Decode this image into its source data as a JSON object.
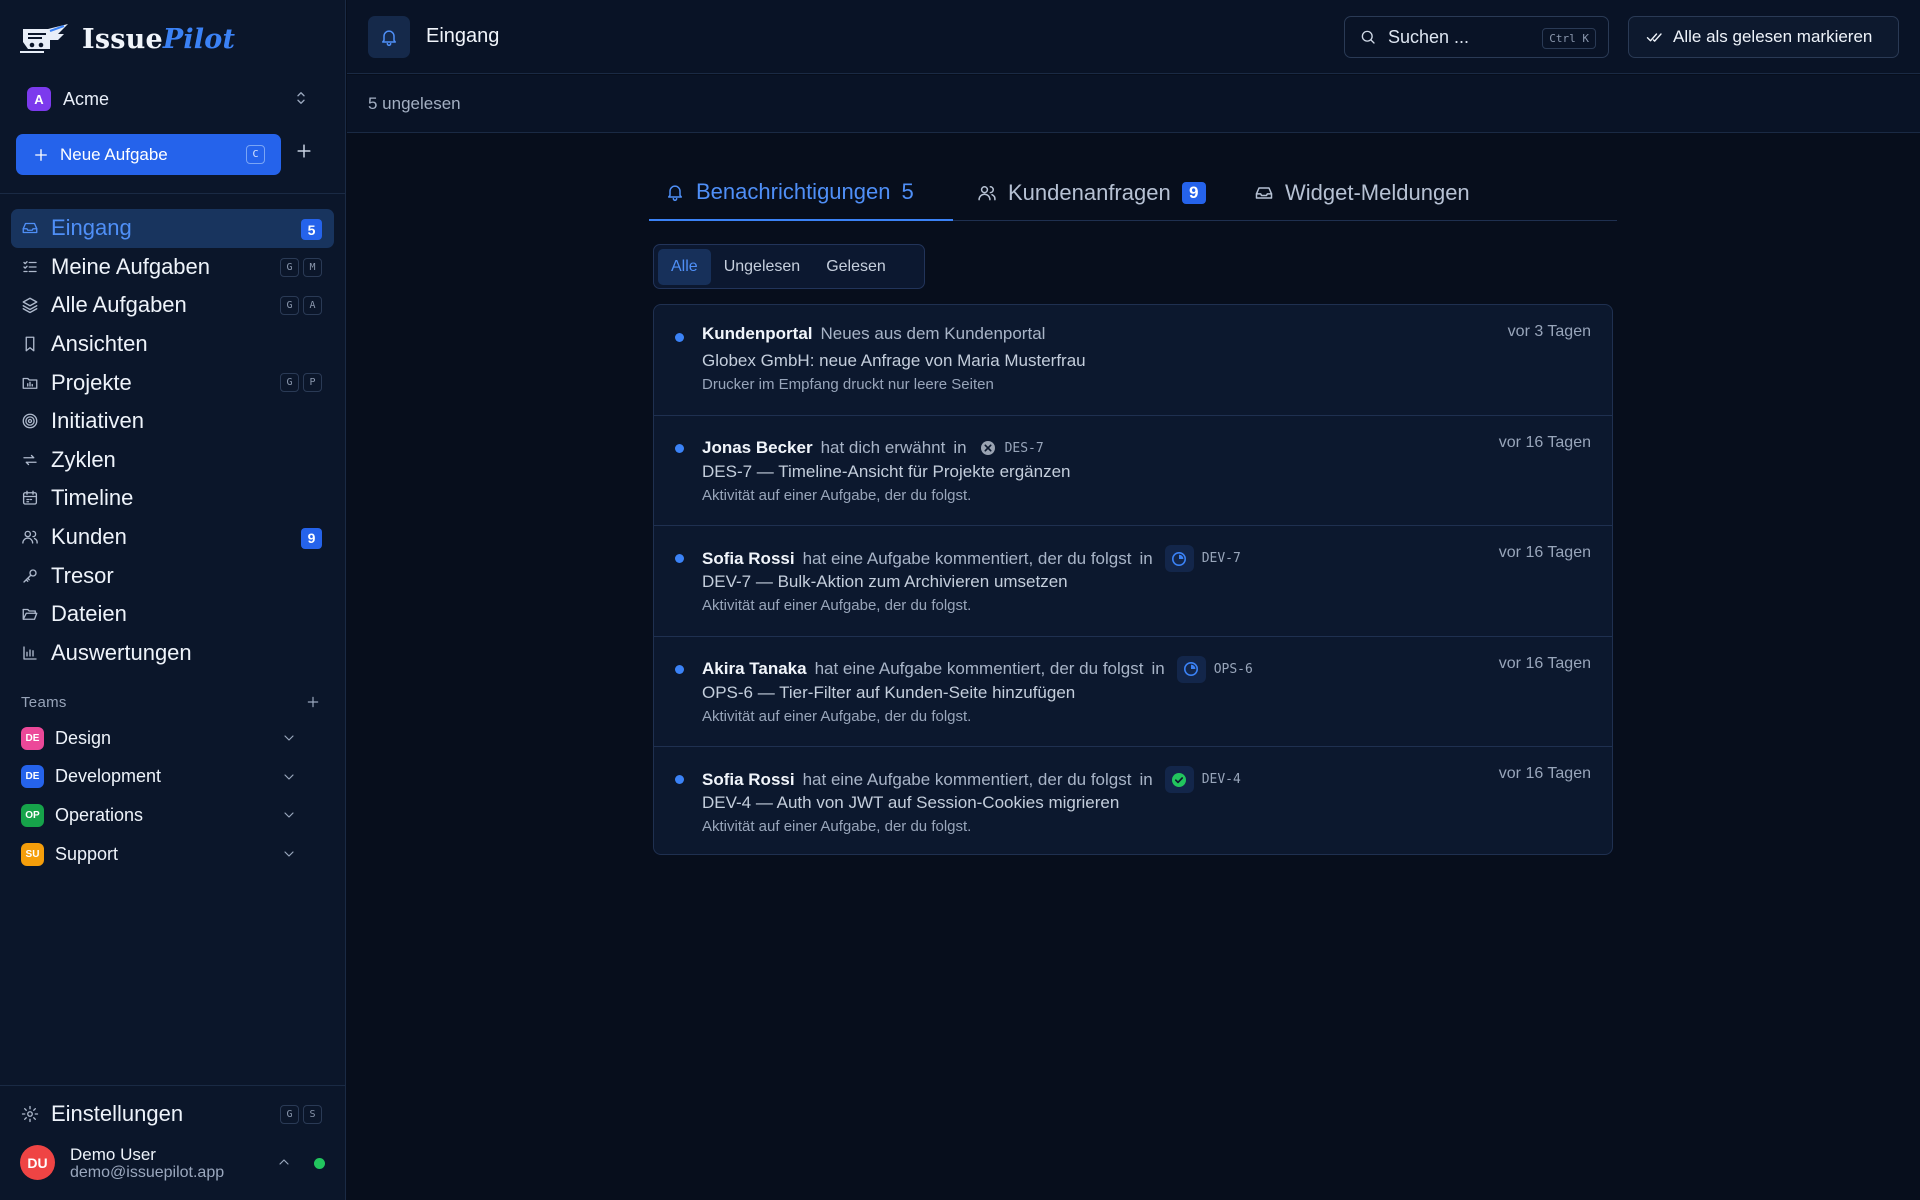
{
  "app": {
    "brand_first": "Issue",
    "brand_second": "Pilot"
  },
  "workspace": {
    "initial": "A",
    "name": "Acme",
    "color": "#7c3aed"
  },
  "new_task": {
    "label": "Neue Aufgabe",
    "shortcut": "C"
  },
  "nav": [
    {
      "label": "Eingang",
      "icon": "inbox-icon",
      "count": "5",
      "active": true
    },
    {
      "label": "Meine Aufgaben",
      "icon": "task-list-icon",
      "keys": [
        "G",
        "M"
      ]
    },
    {
      "label": "Alle Aufgaben",
      "icon": "layers-icon",
      "keys": [
        "G",
        "A"
      ]
    },
    {
      "label": "Ansichten",
      "icon": "bookmark-icon"
    },
    {
      "label": "Projekte",
      "icon": "folder-chart-icon",
      "keys": [
        "G",
        "P"
      ]
    },
    {
      "label": "Initiativen",
      "icon": "target-icon"
    },
    {
      "label": "Zyklen",
      "icon": "cycle-icon"
    },
    {
      "label": "Timeline",
      "icon": "calendar-icon"
    },
    {
      "label": "Kunden",
      "icon": "users-icon",
      "count": "9"
    },
    {
      "label": "Tresor",
      "icon": "key-icon"
    },
    {
      "label": "Dateien",
      "icon": "folder-open-icon"
    },
    {
      "label": "Auswertungen",
      "icon": "bar-chart-icon"
    }
  ],
  "teams_heading": "Teams",
  "teams": [
    {
      "initials": "DE",
      "name": "Design",
      "color": "#ec4899"
    },
    {
      "initials": "DE",
      "name": "Development",
      "color": "#2563eb"
    },
    {
      "initials": "OP",
      "name": "Operations",
      "color": "#16a34a"
    },
    {
      "initials": "SU",
      "name": "Support",
      "color": "#f59e0b"
    }
  ],
  "settings": {
    "label": "Einstellungen",
    "keys": [
      "G",
      "S"
    ]
  },
  "user": {
    "initials": "DU",
    "name": "Demo User",
    "email": "demo@issuepilot.app",
    "status_color": "#22c55e"
  },
  "header": {
    "title": "Eingang",
    "search_label": "Suchen ...",
    "search_shortcut": "Ctrl K",
    "mark_all": "Alle als gelesen markieren"
  },
  "unread_summary": "5 ungelesen",
  "tabs": [
    {
      "label": "Benachrichtigungen",
      "count": "5",
      "icon": "bell-icon",
      "active": true
    },
    {
      "label": "Kundenanfragen",
      "count": "9",
      "icon": "users-icon"
    },
    {
      "label": "Widget-Meldungen",
      "icon": "inbox-icon"
    }
  ],
  "filters": [
    {
      "label": "Alle",
      "active": true
    },
    {
      "label": "Ungelesen"
    },
    {
      "label": "Gelesen"
    }
  ],
  "notifications": [
    {
      "actor": "Kundenportal",
      "action": "Neues aus dem Kundenportal",
      "title": "Globex GmbH: neue Anfrage von Maria Musterfrau",
      "detail": "Drucker im Empfang druckt nur leere Seiten",
      "time": "vor 3 Tagen"
    },
    {
      "actor": "Jonas Becker",
      "action": "hat dich erwähnt",
      "in": "in",
      "ref_code": "DES-7",
      "ref_status": "cancelled-icon",
      "title": "DES-7 — Timeline-Ansicht für Projekte ergänzen",
      "detail": "Aktivität auf einer Aufgabe, der du folgst.",
      "time": "vor 16 Tagen"
    },
    {
      "actor": "Sofia Rossi",
      "action": "hat eine Aufgabe kommentiert, der du folgst",
      "in": "in",
      "ref_code": "DEV-7",
      "ref_status": "in-progress-icon",
      "title": "DEV-7 — Bulk-Aktion zum Archivieren umsetzen",
      "detail": "Aktivität auf einer Aufgabe, der du folgst.",
      "time": "vor 16 Tagen"
    },
    {
      "actor": "Akira Tanaka",
      "action": "hat eine Aufgabe kommentiert, der du folgst",
      "in": "in",
      "ref_code": "OPS-6",
      "ref_status": "in-progress-icon",
      "title": "OPS-6 — Tier-Filter auf Kunden-Seite hinzufügen",
      "detail": "Aktivität auf einer Aufgabe, der du folgst.",
      "time": "vor 16 Tagen"
    },
    {
      "actor": "Sofia Rossi",
      "action": "hat eine Aufgabe kommentiert, der du folgst",
      "in": "in",
      "ref_code": "DEV-4",
      "ref_status": "done-icon",
      "title": "DEV-4 — Auth von JWT auf Session-Cookies migrieren",
      "detail": "Aktivität auf einer Aufgabe, der du folgst.",
      "time": "vor 16 Tagen"
    }
  ],
  "colors": {
    "accent": "#3b82f6",
    "accent_button": "#2563eb",
    "background": "#070e1c",
    "sidebar": "#0b162a"
  }
}
